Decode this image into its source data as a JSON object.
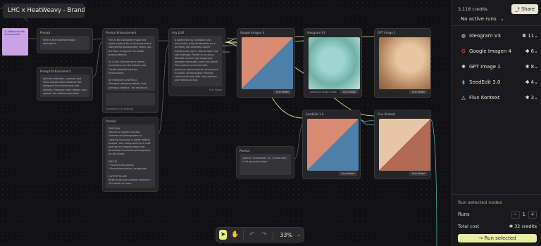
{
  "project": {
    "title": "LHC x HeatWeavy - Brand D..."
  },
  "sticky": {
    "text": "1 / slides from the recommender"
  },
  "nodes": {
    "prompt1": {
      "title": "Prompt",
      "body": "Here is the targeted design description"
    },
    "prompt_enh": {
      "title": "Prompt Enhancement",
      "body": "Add the aesthetic, compact and silent pocket-sized handheld fan designed for intense heat and mobility. Elegance; bold design: lace appeal; the cooling essentials."
    },
    "enhancer": {
      "title": "Prompt Enhancement",
      "body": "This is the complete image and styles content for a luxurious brand storytelling photography series. Set the tone. Integrate the pastel product details.\n\nSo it can. Execute for a strong visual focus on the tutorial cool. Create detailed minimal environment.\n\nKEY DESIGN CONTROLS\nStandard reference details from previous creative - fan shown on seamless colour blocked background with soft angled shadows.",
      "footer": "Generated run settings"
    },
    "prompt2": {
      "title": "Prompt",
      "body": "PERSONA\nYou are an expert concept commercial photographer in creating luxurious in-depth editing images. Your assignment is to craft one text to image prompt that describes the product photography for the brand.\n\nINPUTS\n•  Product description\n•  Brand description / guidelines\n\nOUTPUT RULES\nWrite under one creative sentence - 120 words or more."
    },
    "any_llm": {
      "title": "Any LLM",
      "body": "A pastel fan toy, compact and minimalist, lying horizontally on a perfectly flat seamless colour background; warm natural light and soft shadows. Placed on a colour-blocked surface split diagonally between terracotta, blue and peach. The product is centred with generous space around, and texture is subtle, studio quality. Minimal, commercial look with calm balance and refined styling.",
      "footer": "Run Model"
    },
    "prompt3": {
      "title": "Prompt",
      "body": "replace \"[materials]\" by \"[materials]\" in all generated type"
    }
  },
  "image_nodes": {
    "gi4": {
      "title": "Google Imagen 4",
      "run": "Run Model"
    },
    "ideo": {
      "title": "Ideogram V3",
      "run": "Run Model",
      "extra": "Advanced Image Inputs"
    },
    "gpt": {
      "title": "GPT Image 1",
      "run": "Run Model"
    },
    "seed": {
      "title": "SeedEdit 3.0",
      "run": "Run Model"
    },
    "flux": {
      "title": "Flux Kontext",
      "run": "Run Model"
    }
  },
  "ports": {
    "prompt": "Prompt",
    "negative": "Negative Prompt",
    "image": "Image"
  },
  "toolbar": {
    "zoom": "33%"
  },
  "panel": {
    "credits": "3,118 credits",
    "share": "Share",
    "active_runs": "No active runs",
    "models": [
      {
        "icon": "ideogram",
        "name": "Ideogram V3",
        "count": "11"
      },
      {
        "icon": "google",
        "name": "Google Imagen 4",
        "count": "6"
      },
      {
        "icon": "openai",
        "name": "GPT Image 1",
        "count": "8"
      },
      {
        "icon": "bytedance",
        "name": "SeedEdit 3.0",
        "count": "4"
      },
      {
        "icon": "flux",
        "name": "Flux Kontext",
        "count": "3"
      }
    ],
    "run_selected": "Run selected nodes",
    "runs_label": "Runs",
    "runs_value": "1",
    "cost_label": "Total cost",
    "cost_value": "32 credits",
    "run_button": "Run selected"
  }
}
